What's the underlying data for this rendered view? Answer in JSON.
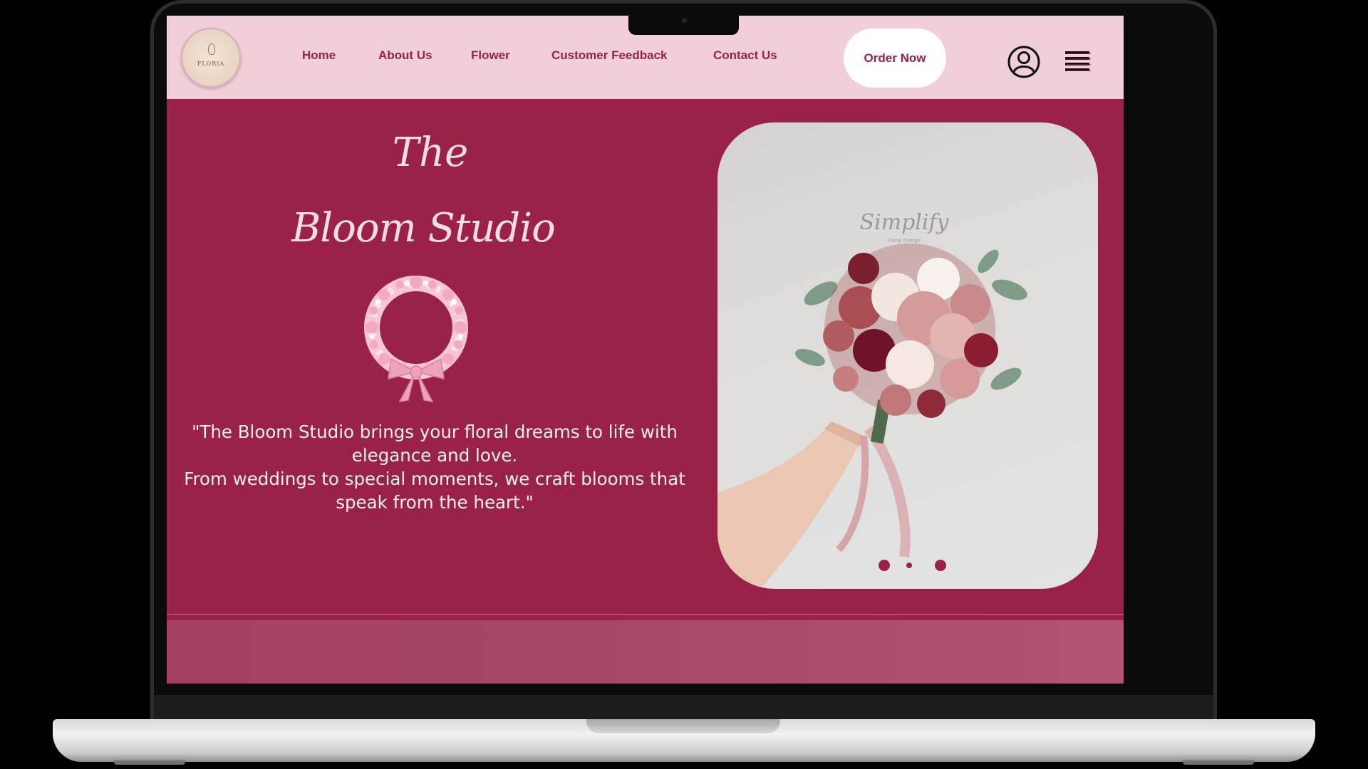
{
  "nav": {
    "logo_text": "FLORIA",
    "links": [
      "Home",
      "About Us",
      "Flower",
      "Customer Feedback",
      "Contact Us"
    ],
    "order_button": "Order Now",
    "icons": [
      "user-icon",
      "hamburger-menu-icon"
    ]
  },
  "hero": {
    "title_line1": "The",
    "title_line2": "Bloom Studio",
    "quote_line1": "\"The Bloom Studio brings your floral dreams to life with elegance and love.",
    "quote_line2": "From weddings to special moments, we craft blooms that speak from the heart.\"",
    "photo_watermark": "Simplify",
    "photo_watermark_sub": "Floral Design",
    "carousel": {
      "slides": 3,
      "active_index": 1
    }
  },
  "colors": {
    "primary": "#9a2249",
    "nav_background": "#f0cfd9",
    "text_light": "#fdf0f3"
  }
}
